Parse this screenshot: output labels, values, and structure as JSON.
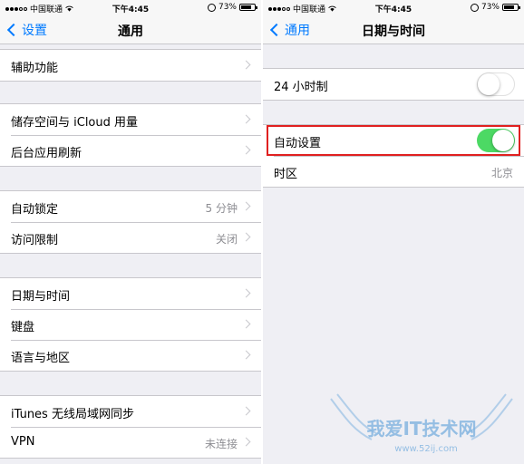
{
  "status": {
    "carrier": "中国联通",
    "time": "下午4:45",
    "battery": "73%",
    "battery_level": 0.73
  },
  "left": {
    "nav": {
      "back_label": "设置",
      "title": "通用"
    },
    "groups": [
      [
        {
          "label": "辅助功能",
          "value": ""
        }
      ],
      [
        {
          "label": "储存空间与 iCloud 用量",
          "value": ""
        },
        {
          "label": "后台应用刷新",
          "value": ""
        }
      ],
      [
        {
          "label": "自动锁定",
          "value": "5 分钟"
        },
        {
          "label": "访问限制",
          "value": "关闭"
        }
      ],
      [
        {
          "label": "日期与时间",
          "value": ""
        },
        {
          "label": "键盘",
          "value": ""
        },
        {
          "label": "语言与地区",
          "value": ""
        }
      ],
      [
        {
          "label": "iTunes 无线局域网同步",
          "value": ""
        },
        {
          "label": "VPN",
          "value": "未连接"
        }
      ]
    ]
  },
  "right": {
    "nav": {
      "back_label": "通用",
      "title": "日期与时间"
    },
    "rows": {
      "hour24": {
        "label": "24 小时制",
        "on": false
      },
      "auto_set": {
        "label": "自动设置",
        "on": true
      },
      "timezone": {
        "label": "时区",
        "value": "北京"
      }
    }
  },
  "colors": {
    "accent": "#007aff",
    "toggle_on": "#4cd964",
    "highlight": "#e02020",
    "background": "#efeff4"
  },
  "watermark": {
    "text": "我爱IT技术网",
    "url": "www.52ij.com"
  }
}
